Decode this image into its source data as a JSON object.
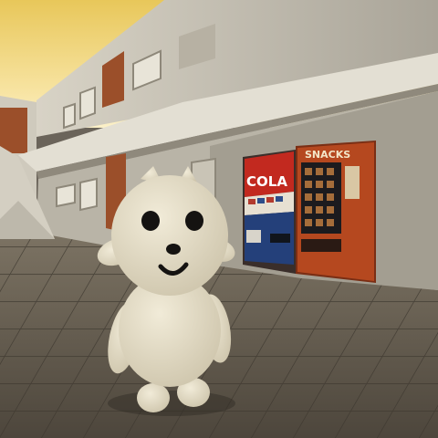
{
  "scene": {
    "cola_machine_sign": "COLA",
    "snacks_machine_sign": "SNACKS"
  },
  "colors": {
    "sky": "#f2d56b",
    "wall": "#c9c4b6",
    "doors": "#9b4f2a",
    "ground": "#5d564b",
    "cola_machine": "#c2291f",
    "snacks_machine": "#b5481f",
    "character": "#e6dfcb"
  }
}
